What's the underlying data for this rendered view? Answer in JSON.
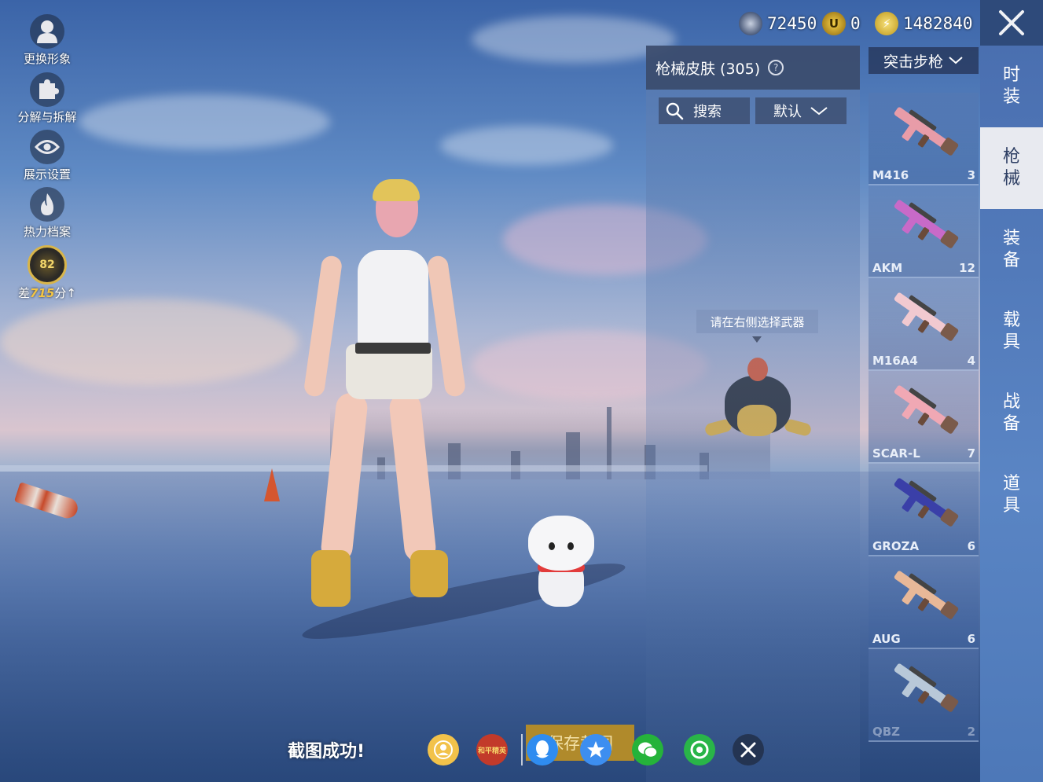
{
  "left_menu": {
    "change_look": "更换形象",
    "dismantle": "分解与拆解",
    "display_settings": "展示设置",
    "heat_archive": "热力档案",
    "rank_level": "82",
    "rank_prefix": "差",
    "rank_points": "715",
    "rank_suffix": "分"
  },
  "currency": {
    "silver": "72450",
    "coupon": "0",
    "energy": "1482840"
  },
  "skins_panel": {
    "title": "枪械皮肤 (305)",
    "help": "?",
    "search": "搜索",
    "sort": "默认",
    "hint": "请在右侧选择武器"
  },
  "weapon_category": "突击步枪",
  "weapons": [
    {
      "name": "M416",
      "count": "3",
      "color": "#e89ca8"
    },
    {
      "name": "AKM",
      "count": "12",
      "color": "#c86ac8"
    },
    {
      "name": "M16A4",
      "count": "4",
      "color": "#f1c9d0"
    },
    {
      "name": "SCAR-L",
      "count": "7",
      "color": "#f0a8b4"
    },
    {
      "name": "GROZA",
      "count": "6",
      "color": "#3a3fa8"
    },
    {
      "name": "AUG",
      "count": "6",
      "color": "#e8b898"
    },
    {
      "name": "QBZ",
      "count": "2",
      "color": "#b8c8d8"
    }
  ],
  "tabs": [
    {
      "label": "时装",
      "active": false
    },
    {
      "label": "枪械",
      "active": true
    },
    {
      "label": "装备",
      "active": false
    },
    {
      "label": "载具",
      "active": false
    },
    {
      "label": "战备",
      "active": false
    },
    {
      "label": "道具",
      "active": false
    }
  ],
  "bottom": {
    "toast": "截图成功!",
    "save_label": "保存截图",
    "game_badge": "和平精英"
  }
}
